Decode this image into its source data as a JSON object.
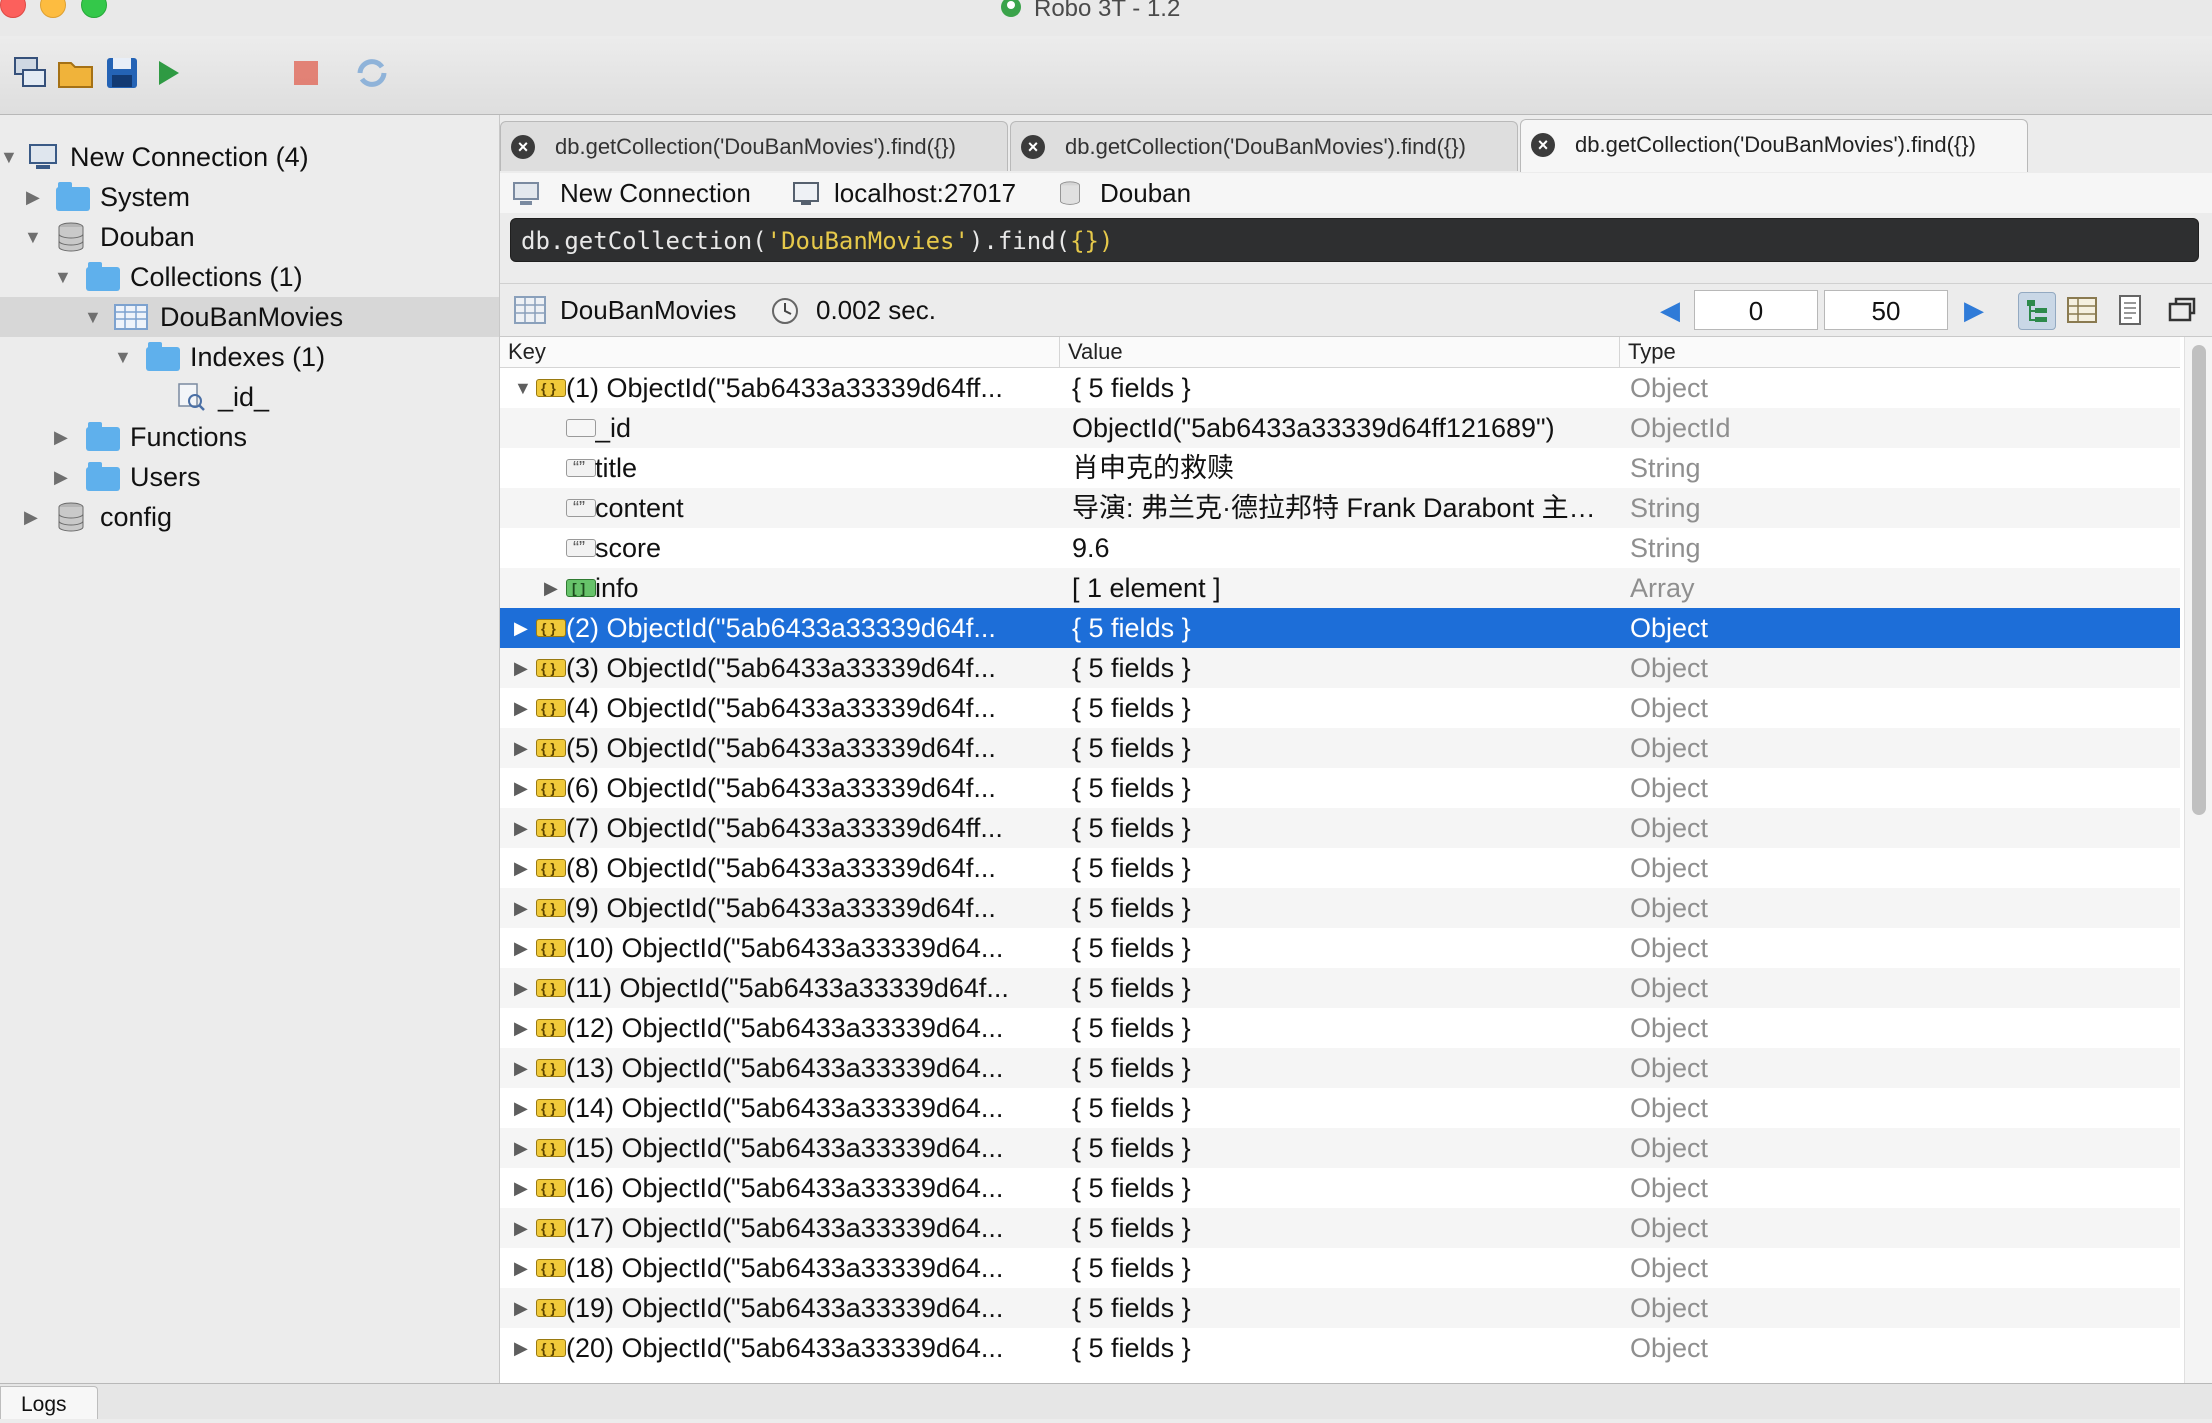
{
  "window": {
    "title": "Robo 3T - 1.2"
  },
  "toolbar": {
    "buttons": [
      "connect",
      "open",
      "save",
      "execute",
      "stop",
      "refresh"
    ]
  },
  "sidebar": {
    "items": [
      {
        "label": "New Connection (4)",
        "icon": "server-icon",
        "expanded": true
      },
      {
        "label": "System",
        "icon": "folder-icon",
        "expanded": false
      },
      {
        "label": "Douban",
        "icon": "database-icon",
        "expanded": true
      },
      {
        "label": "Collections (1)",
        "icon": "folder-icon",
        "expanded": true
      },
      {
        "label": "DouBanMovies",
        "icon": "collection-icon",
        "expanded": true,
        "selected": true
      },
      {
        "label": "Indexes (1)",
        "icon": "folder-icon",
        "expanded": true
      },
      {
        "label": "_id_",
        "icon": "index-icon"
      },
      {
        "label": "Functions",
        "icon": "folder-icon",
        "expanded": false
      },
      {
        "label": "Users",
        "icon": "folder-icon",
        "expanded": false
      },
      {
        "label": "config",
        "icon": "database-icon",
        "expanded": false
      }
    ]
  },
  "tabs": [
    {
      "label": "db.getCollection('DouBanMovies').find({})",
      "active": false
    },
    {
      "label": "db.getCollection('DouBanMovies').find({})",
      "active": false
    },
    {
      "label": "db.getCollection('DouBanMovies').find({})",
      "active": true
    }
  ],
  "connection": {
    "name": "New Connection",
    "host": "localhost:27017",
    "database": "Douban"
  },
  "query": {
    "prefix": "db.getCollection(",
    "string": "'DouBanMovies'",
    "middle": ").find(",
    "arg": "{}",
    "suffix": ")"
  },
  "results": {
    "collection": "DouBanMovies",
    "time": "0.002 sec.",
    "skip": "0",
    "limit": "50"
  },
  "grid": {
    "headers": {
      "key": "Key",
      "value": "Value",
      "type": "Type"
    },
    "rows": [
      {
        "key": "(1) ObjectId(\"5ab6433a33339d64ff...",
        "value": "{ 5 fields }",
        "type": "Object",
        "level": 0,
        "arrow": "expanded",
        "icon": "object"
      },
      {
        "key": "_id",
        "value": "ObjectId(\"5ab6433a33339d64ff121689\")",
        "type": "ObjectId",
        "level": 1,
        "arrow": "none",
        "icon": "objectid"
      },
      {
        "key": "title",
        "value": "肖申克的救赎",
        "type": "String",
        "level": 1,
        "arrow": "none",
        "icon": "string"
      },
      {
        "key": "content",
        "value": "导演: 弗兰克·德拉邦特 Frank Darabont 主演...",
        "type": "String",
        "level": 1,
        "arrow": "none",
        "icon": "string"
      },
      {
        "key": "score",
        "value": "9.6",
        "type": "String",
        "level": 1,
        "arrow": "none",
        "icon": "string"
      },
      {
        "key": "info",
        "value": "[ 1 element ]",
        "type": "Array",
        "level": 1,
        "arrow": "collapsed",
        "icon": "array"
      },
      {
        "key": "(2) ObjectId(\"5ab6433a33339d64f...",
        "value": "{ 5 fields }",
        "type": "Object",
        "level": 0,
        "arrow": "collapsed",
        "icon": "object",
        "selected": true
      },
      {
        "key": "(3) ObjectId(\"5ab6433a33339d64f...",
        "value": "{ 5 fields }",
        "type": "Object",
        "level": 0,
        "arrow": "collapsed",
        "icon": "object"
      },
      {
        "key": "(4) ObjectId(\"5ab6433a33339d64f...",
        "value": "{ 5 fields }",
        "type": "Object",
        "level": 0,
        "arrow": "collapsed",
        "icon": "object"
      },
      {
        "key": "(5) ObjectId(\"5ab6433a33339d64f...",
        "value": "{ 5 fields }",
        "type": "Object",
        "level": 0,
        "arrow": "collapsed",
        "icon": "object"
      },
      {
        "key": "(6) ObjectId(\"5ab6433a33339d64f...",
        "value": "{ 5 fields }",
        "type": "Object",
        "level": 0,
        "arrow": "collapsed",
        "icon": "object"
      },
      {
        "key": "(7) ObjectId(\"5ab6433a33339d64ff...",
        "value": "{ 5 fields }",
        "type": "Object",
        "level": 0,
        "arrow": "collapsed",
        "icon": "object"
      },
      {
        "key": "(8) ObjectId(\"5ab6433a33339d64f...",
        "value": "{ 5 fields }",
        "type": "Object",
        "level": 0,
        "arrow": "collapsed",
        "icon": "object"
      },
      {
        "key": "(9) ObjectId(\"5ab6433a33339d64f...",
        "value": "{ 5 fields }",
        "type": "Object",
        "level": 0,
        "arrow": "collapsed",
        "icon": "object"
      },
      {
        "key": "(10) ObjectId(\"5ab6433a33339d64...",
        "value": "{ 5 fields }",
        "type": "Object",
        "level": 0,
        "arrow": "collapsed",
        "icon": "object"
      },
      {
        "key": "(11) ObjectId(\"5ab6433a33339d64f...",
        "value": "{ 5 fields }",
        "type": "Object",
        "level": 0,
        "arrow": "collapsed",
        "icon": "object"
      },
      {
        "key": "(12) ObjectId(\"5ab6433a33339d64...",
        "value": "{ 5 fields }",
        "type": "Object",
        "level": 0,
        "arrow": "collapsed",
        "icon": "object"
      },
      {
        "key": "(13) ObjectId(\"5ab6433a33339d64...",
        "value": "{ 5 fields }",
        "type": "Object",
        "level": 0,
        "arrow": "collapsed",
        "icon": "object"
      },
      {
        "key": "(14) ObjectId(\"5ab6433a33339d64...",
        "value": "{ 5 fields }",
        "type": "Object",
        "level": 0,
        "arrow": "collapsed",
        "icon": "object"
      },
      {
        "key": "(15) ObjectId(\"5ab6433a33339d64...",
        "value": "{ 5 fields }",
        "type": "Object",
        "level": 0,
        "arrow": "collapsed",
        "icon": "object"
      },
      {
        "key": "(16) ObjectId(\"5ab6433a33339d64...",
        "value": "{ 5 fields }",
        "type": "Object",
        "level": 0,
        "arrow": "collapsed",
        "icon": "object"
      },
      {
        "key": "(17) ObjectId(\"5ab6433a33339d64...",
        "value": "{ 5 fields }",
        "type": "Object",
        "level": 0,
        "arrow": "collapsed",
        "icon": "object"
      },
      {
        "key": "(18) ObjectId(\"5ab6433a33339d64...",
        "value": "{ 5 fields }",
        "type": "Object",
        "level": 0,
        "arrow": "collapsed",
        "icon": "object"
      },
      {
        "key": "(19) ObjectId(\"5ab6433a33339d64...",
        "value": "{ 5 fields }",
        "type": "Object",
        "level": 0,
        "arrow": "collapsed",
        "icon": "object"
      },
      {
        "key": "(20) ObjectId(\"5ab6433a33339d64...",
        "value": "{ 5 fields }",
        "type": "Object",
        "level": 0,
        "arrow": "collapsed",
        "icon": "object"
      }
    ]
  },
  "bottom": {
    "logs_label": "Logs"
  },
  "colors": {
    "selection": "#1d6ed8",
    "query_bg": "#2e2f30",
    "query_string": "#e6c94a"
  }
}
